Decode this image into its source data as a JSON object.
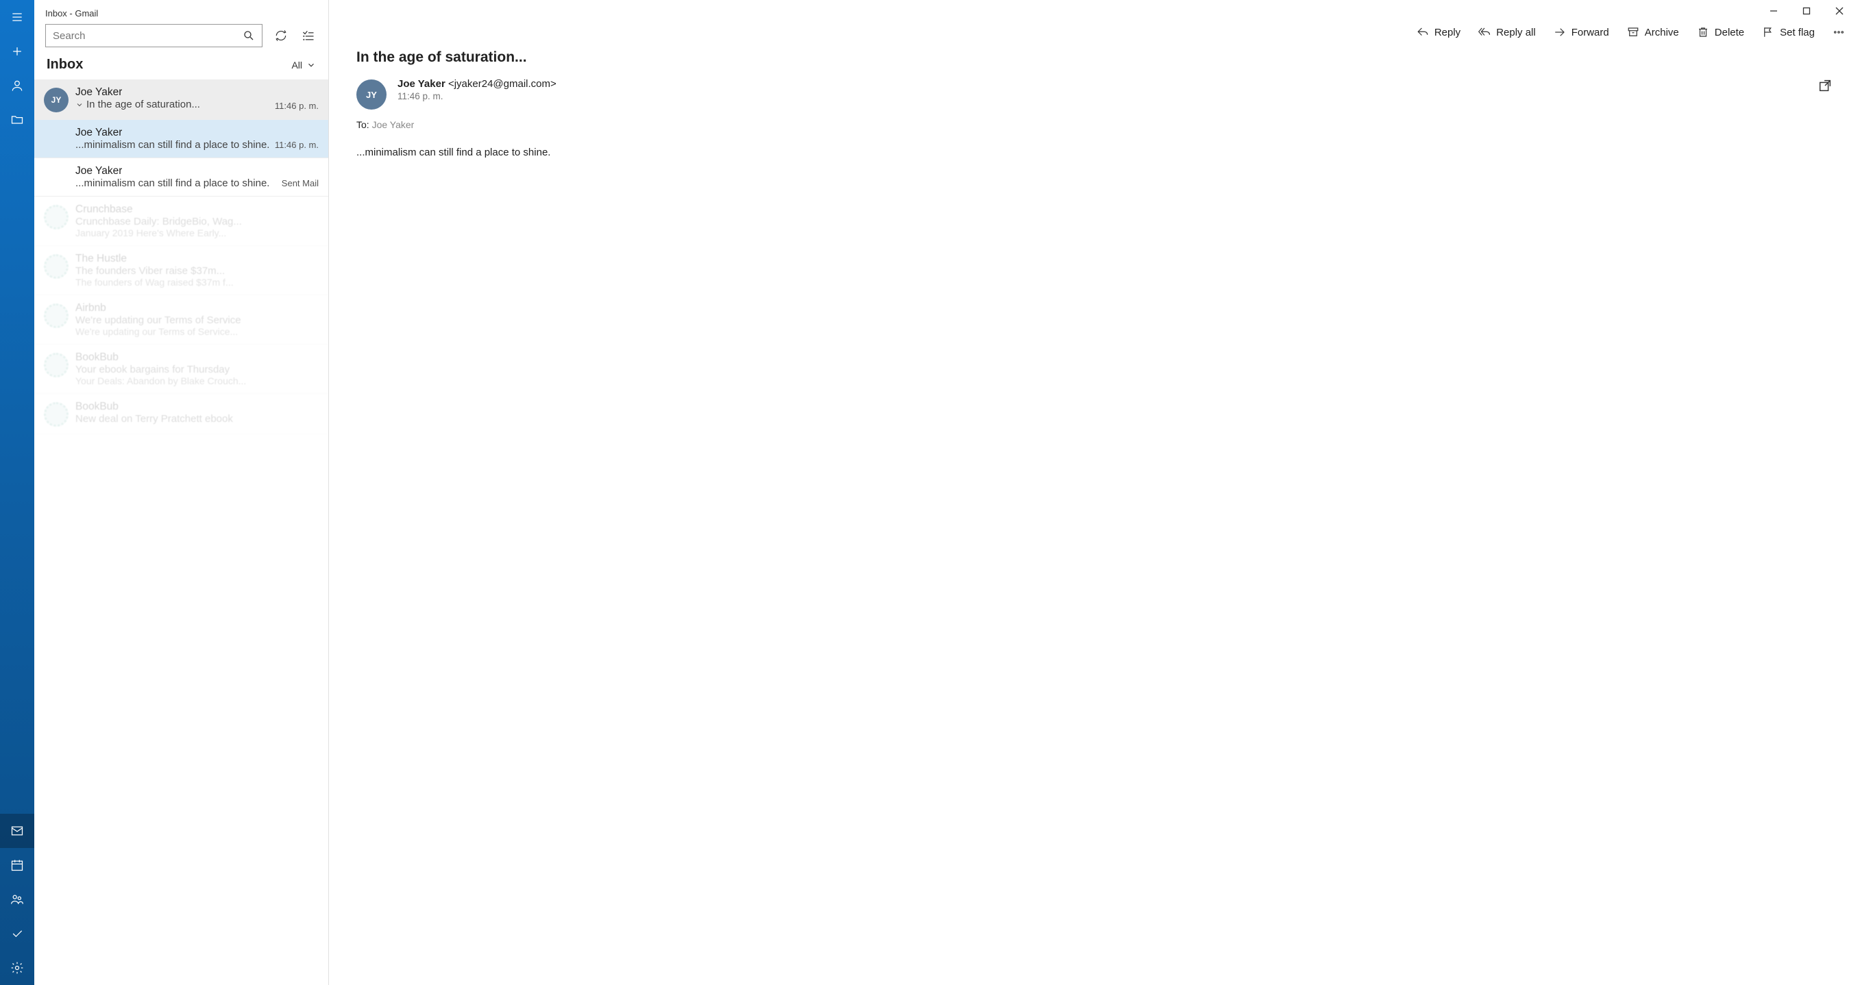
{
  "window": {
    "title": "Inbox - Gmail"
  },
  "search": {
    "placeholder": "Search"
  },
  "folder": {
    "name": "Inbox",
    "filter": "All"
  },
  "rail_icons": [
    "menu",
    "compose",
    "account",
    "folder",
    "mail",
    "calendar",
    "people",
    "todo",
    "settings"
  ],
  "messages": [
    {
      "from": "Joe Yaker",
      "subject": "In the age of saturation...",
      "time": "11:46 p. m.",
      "avatar": "JY",
      "parent": true,
      "expand": true
    },
    {
      "from": "Joe Yaker",
      "subject": "...minimalism can still find a place to shine.",
      "time": "11:46 p. m.",
      "selected": true,
      "indent": true
    },
    {
      "from": "Joe Yaker",
      "subject": "...minimalism can still find a place to shine.",
      "time": "Sent Mail",
      "indent": true
    },
    {
      "from": "Crunchbase",
      "subject": "Crunchbase Daily: BridgeBio, Wag...",
      "preview": "January 2019 Here's Where Early...",
      "time": "",
      "faded": true,
      "ring": true
    },
    {
      "from": "The Hustle",
      "subject": "The founders Viber raise $37m...",
      "preview": "The founders of Wag raised $37m f...",
      "time": "",
      "faded": true,
      "ring": true
    },
    {
      "from": "Airbnb",
      "subject": "We're updating our Terms of Service",
      "preview": "We're updating our Terms of Service...",
      "time": "",
      "faded": true,
      "ring": true
    },
    {
      "from": "BookBub",
      "subject": "Your ebook bargains for Thursday",
      "preview": "Your Deals: Abandon by Blake Crouch...",
      "time": "",
      "faded": true,
      "ring": true
    },
    {
      "from": "BookBub",
      "subject": "New deal on Terry Pratchett ebook",
      "preview": "",
      "time": "",
      "faded": true,
      "ring": true
    }
  ],
  "actions": {
    "reply": "Reply",
    "reply_all": "Reply all",
    "forward": "Forward",
    "archive": "Archive",
    "delete": "Delete",
    "flag": "Set flag"
  },
  "mail": {
    "subject": "In the age of saturation...",
    "from_name": "Joe Yaker",
    "from_addr": "<jyaker24@gmail.com>",
    "time": "11:46 p. m.",
    "to_label": "To:",
    "to_value": "Joe Yaker",
    "avatar": "JY",
    "body": "...minimalism can still find a place to shine."
  }
}
